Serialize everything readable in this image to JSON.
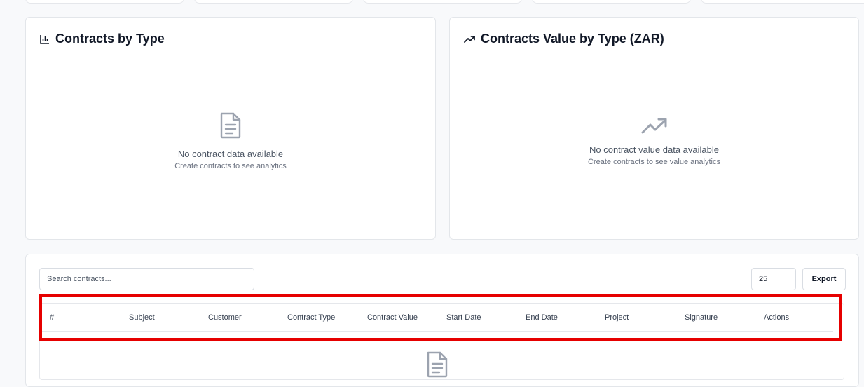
{
  "charts": {
    "type_card": {
      "title": "Contracts by Type",
      "title_icon": "bar-chart-icon",
      "empty_icon": "document-icon",
      "empty_message": "No contract data available",
      "empty_sub": "Create contracts to see analytics"
    },
    "value_card": {
      "title": "Contracts Value by Type (ZAR)",
      "title_icon": "trending-up-icon",
      "empty_icon": "trending-up-icon",
      "empty_message": "No contract value data available",
      "empty_sub": "Create contracts to see value analytics"
    }
  },
  "table": {
    "search_placeholder": "Search contracts...",
    "per_page": "25",
    "export_label": "Export",
    "columns": [
      "#",
      "Subject",
      "Customer",
      "Contract Type",
      "Contract Value",
      "Start Date",
      "End Date",
      "Project",
      "Signature",
      "Actions"
    ],
    "empty_icon": "document-icon"
  },
  "colors": {
    "highlight_border": "#e60000",
    "icon_gray": "#9ca3af"
  }
}
